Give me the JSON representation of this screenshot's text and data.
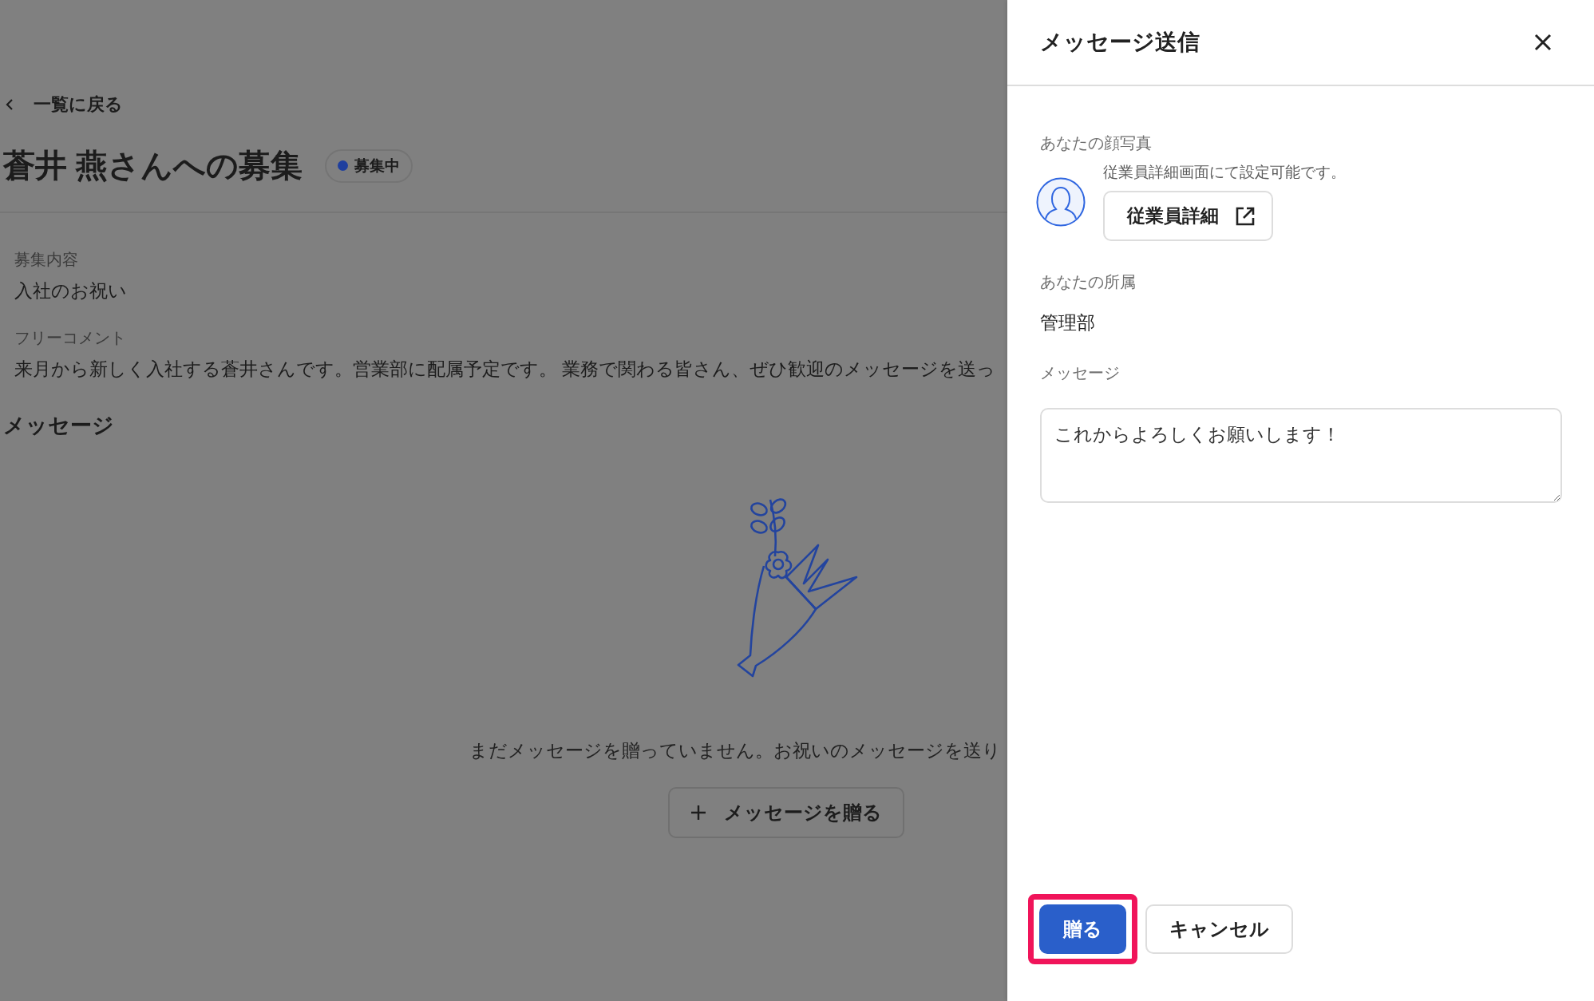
{
  "back_link": {
    "label": "一覧に戻る"
  },
  "page": {
    "title": "蒼井 燕さんへの募集",
    "status": {
      "label": "募集中"
    }
  },
  "details": [
    {
      "label": "募集内容",
      "value": "入社のお祝い"
    },
    {
      "label": "フリーコメント",
      "value": "来月から新しく入社する蒼井さんです。営業部に配属予定です。 業務で関わる皆さん、ぜひ歓迎のメッセージを送っ"
    }
  ],
  "messages": {
    "heading": "メッセージ",
    "empty_text": "まだメッセージを贈っていません。お祝いのメッセージを送り",
    "add_button": "メッセージを贈る"
  },
  "drawer": {
    "title": "メッセージ送信",
    "photo": {
      "label": "あなたの顔写真",
      "hint": "従業員詳細画面にて設定可能です。",
      "button": "従業員詳細"
    },
    "department": {
      "label": "あなたの所属",
      "value": "管理部"
    },
    "message": {
      "label": "メッセージ",
      "value": "これからよろしくお願いします！"
    },
    "buttons": [
      {
        "label": "贈る",
        "kind": "primary",
        "highlighted": true
      },
      {
        "label": "キャンセル",
        "kind": "secondary",
        "highlighted": false
      }
    ]
  }
}
